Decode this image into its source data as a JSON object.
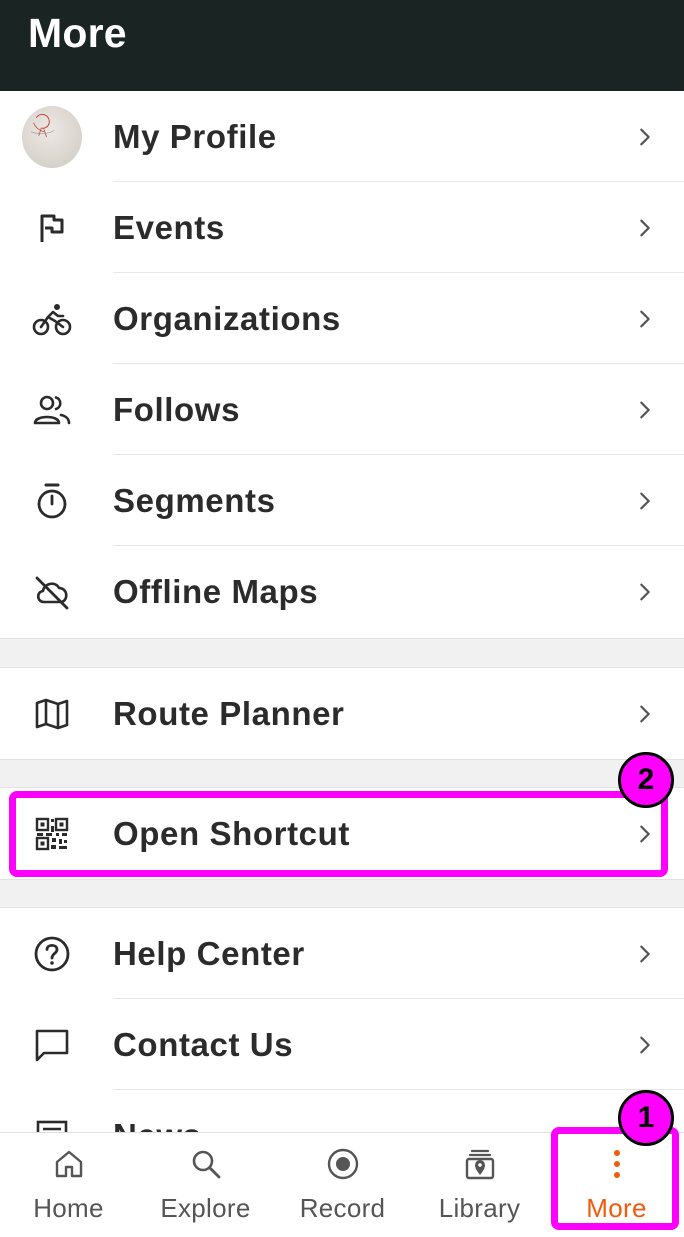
{
  "header": {
    "title": "More"
  },
  "menu_group_1": [
    {
      "label": "My Profile",
      "icon": "avatar"
    },
    {
      "label": "Events",
      "icon": "flag-icon"
    },
    {
      "label": "Organizations",
      "icon": "cyclist-icon"
    },
    {
      "label": "Follows",
      "icon": "people-icon"
    },
    {
      "label": "Segments",
      "icon": "stopwatch-icon"
    },
    {
      "label": "Offline Maps",
      "icon": "cloud-off-icon"
    }
  ],
  "menu_group_2": [
    {
      "label": "Route Planner",
      "icon": "map-icon"
    }
  ],
  "menu_group_3": [
    {
      "label": "Open Shortcut",
      "icon": "qr-code-icon"
    }
  ],
  "menu_group_4": [
    {
      "label": "Help Center",
      "icon": "help-circle-icon"
    },
    {
      "label": "Contact Us",
      "icon": "chat-icon"
    },
    {
      "label": "News",
      "icon": "newspaper-icon"
    }
  ],
  "annotations": [
    {
      "number": "1",
      "target": "More"
    },
    {
      "number": "2",
      "target": "Open Shortcut"
    }
  ],
  "bottom_nav": [
    {
      "label": "Home",
      "icon": "home-icon",
      "active": false
    },
    {
      "label": "Explore",
      "icon": "search-icon",
      "active": false
    },
    {
      "label": "Record",
      "icon": "record-icon",
      "active": false
    },
    {
      "label": "Library",
      "icon": "library-icon",
      "active": false
    },
    {
      "label": "More",
      "icon": "more-vertical-icon",
      "active": true
    }
  ],
  "version_text": "",
  "colors": {
    "header_bg": "#1a2423",
    "accent": "#f25a0c",
    "highlight": "#ff00ff"
  }
}
